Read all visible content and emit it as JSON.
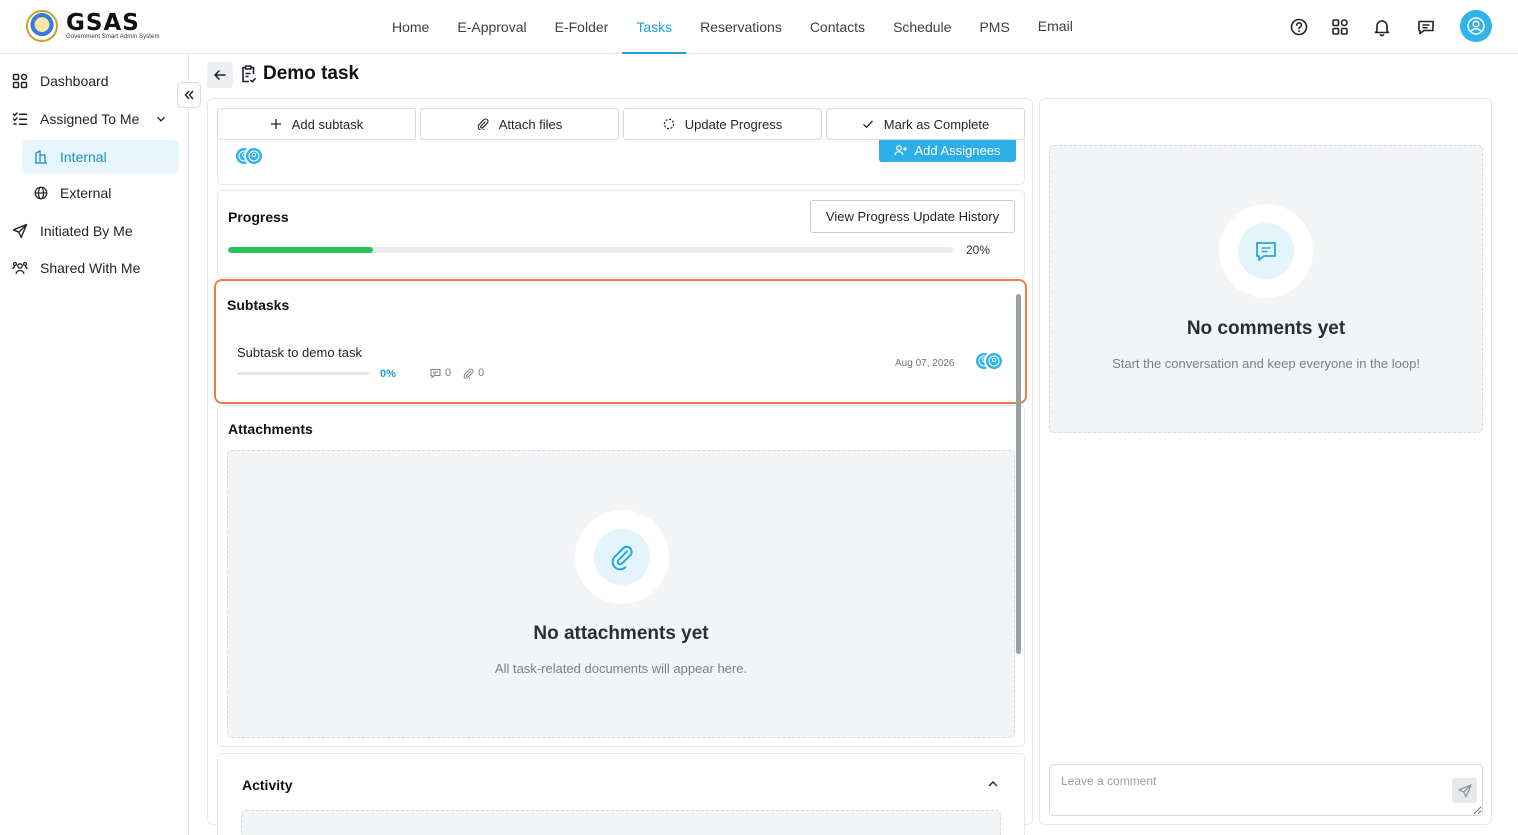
{
  "header": {
    "logo_title": "GSAS",
    "logo_subtitle": "Government Smart Admin System",
    "nav": [
      "Home",
      "E-Approval",
      "E-Folder",
      "Tasks",
      "Reservations",
      "Contacts",
      "Schedule",
      "PMS",
      "Email"
    ],
    "active_nav": "Tasks"
  },
  "sidebar": {
    "dashboard": "Dashboard",
    "assigned_to_me": "Assigned To Me",
    "internal": "Internal",
    "external": "External",
    "initiated_by_me": "Initiated By Me",
    "shared_with_me": "Shared With Me"
  },
  "page": {
    "title": "Demo task"
  },
  "actions": {
    "add_subtask": "Add subtask",
    "attach_files": "Attach files",
    "update_progress": "Update Progress",
    "mark_complete": "Mark as Complete"
  },
  "assignees": {
    "add_button": "Add Assignees"
  },
  "progress": {
    "title": "Progress",
    "history_button": "View Progress Update History",
    "value_percent": 20,
    "label": "20%"
  },
  "subtasks": {
    "title": "Subtasks",
    "items": [
      {
        "name": "Subtask to demo task",
        "progress_label": "0%",
        "progress_percent": 0,
        "comments": "0",
        "attachments": "0",
        "due_date": "Aug 07, 2026"
      }
    ]
  },
  "attachments": {
    "title": "Attachments",
    "empty_title": "No attachments yet",
    "empty_subtitle": "All task-related documents will appear here."
  },
  "activity": {
    "title": "Activity"
  },
  "comments": {
    "empty_title": "No comments yet",
    "empty_subtitle": "Start the conversation and keep everyone in the loop!",
    "input_placeholder": "Leave a comment"
  },
  "colors": {
    "accent": "#22a2d9",
    "progress_fill": "#2bc25a",
    "highlight_border": "#ee7a4f"
  }
}
